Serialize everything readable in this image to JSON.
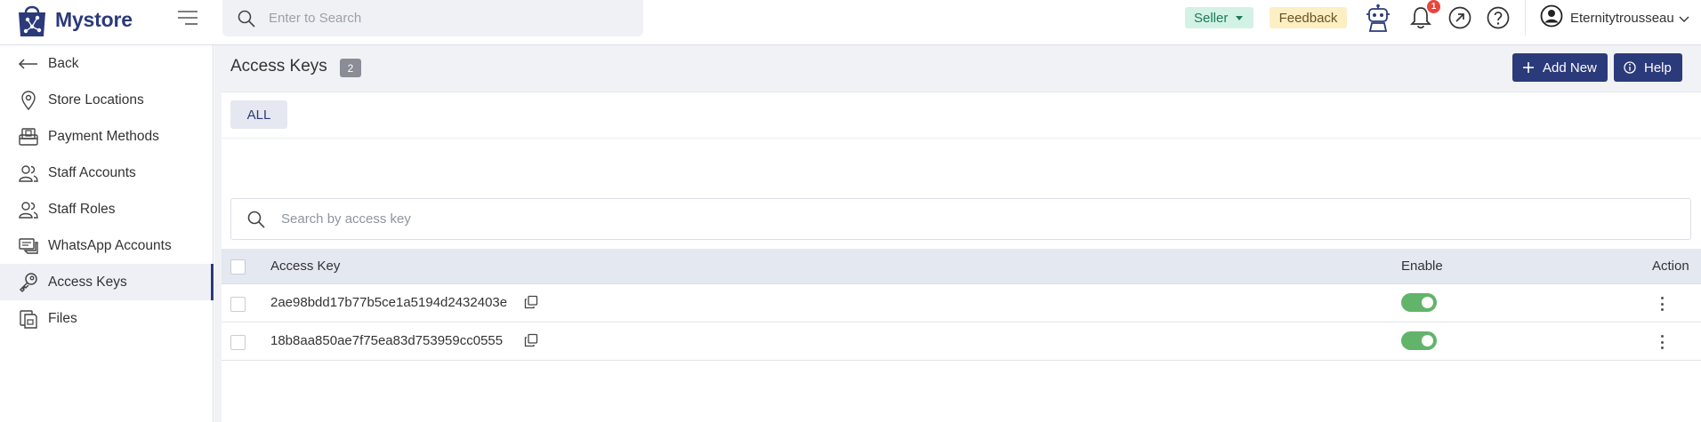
{
  "brand": {
    "name": "Mystore",
    "accent": "#2b3a7a"
  },
  "topbar": {
    "search_placeholder": "Enter to Search",
    "seller_label": "Seller",
    "feedback_label": "Feedback",
    "notification_count": "1",
    "user_name": "Eternitytrousseau",
    "icons": [
      "robot-icon",
      "bell-icon",
      "external-link-icon",
      "help-circle-icon",
      "user-avatar-icon"
    ]
  },
  "sidebar": {
    "items": [
      {
        "label": "Back",
        "icon": "arrow-left-icon"
      },
      {
        "label": "Store Locations",
        "icon": "location-pin-icon"
      },
      {
        "label": "Payment Methods",
        "icon": "payment-icon"
      },
      {
        "label": "Staff Accounts",
        "icon": "users-icon"
      },
      {
        "label": "Staff Roles",
        "icon": "user-role-icon"
      },
      {
        "label": "WhatsApp Accounts",
        "icon": "chat-icon"
      },
      {
        "label": "Access Keys",
        "icon": "key-icon",
        "active": true
      },
      {
        "label": "Files",
        "icon": "files-icon"
      }
    ]
  },
  "main": {
    "title": "Access Keys",
    "count": "2",
    "add_new_label": "Add New",
    "help_label": "Help",
    "tabs": [
      {
        "label": "ALL",
        "active": true
      }
    ],
    "search_placeholder": "Search by access key",
    "table": {
      "headers": {
        "key": "Access Key",
        "enable": "Enable",
        "action": "Action"
      },
      "rows": [
        {
          "key": "2ae98bdd17b77b5ce1a5194d2432403e",
          "enabled": true
        },
        {
          "key": "18b8aa850ae7f75ea83d753959cc0555",
          "enabled": true
        }
      ]
    }
  },
  "colors": {
    "enabled_toggle": "#62b46a",
    "seller_bg": "#d3f2e6",
    "feedback_bg": "#fcefc4",
    "notification": "#e8453c"
  }
}
